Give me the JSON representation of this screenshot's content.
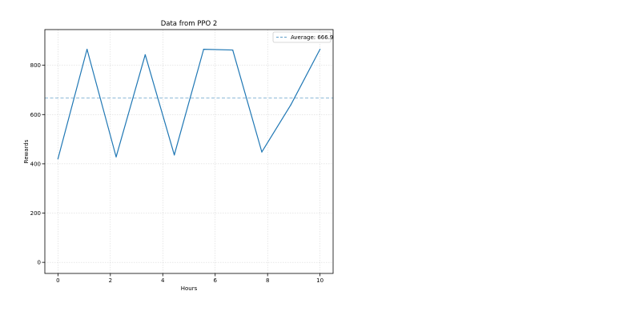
{
  "chart_data": {
    "type": "line",
    "title": "Data from PPO 2",
    "xlabel": "Hours",
    "ylabel": "Rewards",
    "xlim": [
      -0.5,
      10.5
    ],
    "ylim": [
      -45,
      945
    ],
    "xticks": [
      0,
      2,
      4,
      6,
      8,
      10
    ],
    "yticks": [
      0,
      200,
      400,
      600,
      800
    ],
    "grid": true,
    "legend_position": "top-right",
    "colors": {
      "line": "#1f77b4",
      "average": "#1f77b4"
    },
    "series": [
      {
        "x": [
          0,
          1.11,
          2.22,
          3.33,
          4.44,
          5.56,
          6.67,
          7.78,
          8.89,
          10
        ],
        "values": [
          420,
          865,
          428,
          843,
          436,
          865,
          862,
          448,
          640,
          865
        ]
      }
    ],
    "average": {
      "label": "Average: 666.9",
      "value": 666.9
    }
  }
}
